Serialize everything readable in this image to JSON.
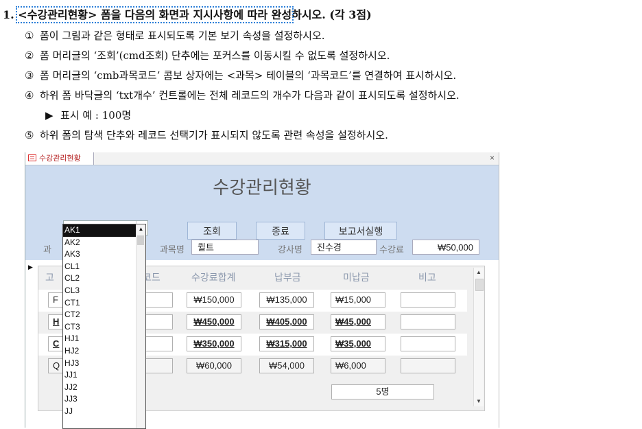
{
  "question": {
    "number": "1.",
    "form_name": "<수강관리현황>",
    "title_rest_a": " 폼을 다음의 화면과 지시사항에 따라 완성",
    "title_rest_b": "하시오. (각 3점)",
    "instructions": [
      {
        "mark": "①",
        "text": "폼이 그림과 같은 형태로 표시되도록 기본 보기 속성을 설정하시오."
      },
      {
        "mark": "②",
        "text": "폼 머리글의 ‘조회’(cmd조회) 단추에는 포커스를 이동시킬 수 없도록 설정하시오."
      },
      {
        "mark": "③",
        "text": "폼 머리글의 ‘cmb과목코드’ 콤보 상자에는 <과목> 테이블의 ‘과목코드’를 연결하여 표시하시오."
      },
      {
        "mark": "④",
        "text": "하위 폼 바닥글의 ‘txt개수’ 컨트롤에는 전체 레코드의 개수가 다음과 같이 표시되도록 설정하시오."
      },
      {
        "mark": "▶",
        "text": "표시 예 : 100명"
      },
      {
        "mark": "⑤",
        "text": "하위 폼의 탐색 단추와 레코드 선택기가 표시되지 않도록 관련 속성을 설정하시오."
      }
    ]
  },
  "window": {
    "tab_label": "수강관리현황",
    "close_glyph": "×",
    "form_title": "수강관리현황",
    "buttons": {
      "query": "조회",
      "exit": "종료",
      "report": "보고서실행"
    },
    "labels": {
      "subject_code_partial": "과",
      "subject_name": "과목명",
      "instructor": "강사명",
      "fee": "수강료"
    },
    "values": {
      "subject_name": "퀼트",
      "instructor": "진수경",
      "fee": "₩50,000"
    }
  },
  "subform": {
    "columns": [
      "고",
      "코드",
      "수강료합계",
      "납부금",
      "미납금",
      "비고"
    ],
    "rows": [
      {
        "code_partial": "F",
        "total": "₩150,000",
        "paid": "₩135,000",
        "unpaid": "₩15,000",
        "bold": false
      },
      {
        "code_partial": "H",
        "total": "₩450,000",
        "paid": "₩405,000",
        "unpaid": "₩45,000",
        "bold": true
      },
      {
        "code_partial": "C",
        "total": "₩350,000",
        "paid": "₩315,000",
        "unpaid": "₩35,000",
        "bold": true
      },
      {
        "code_partial": "Q",
        "total": "₩60,000",
        "paid": "₩54,000",
        "unpaid": "₩6,000",
        "bold": false
      }
    ],
    "count": "5명"
  },
  "combo_list": {
    "selected": "AK1",
    "items": [
      "AK1",
      "AK2",
      "AK3",
      "CL1",
      "CL2",
      "CL3",
      "CT1",
      "CT2",
      "CT3",
      "HJ1",
      "HJ2",
      "HJ3",
      "JJ1",
      "JJ2",
      "JJ3",
      "JJ"
    ]
  }
}
